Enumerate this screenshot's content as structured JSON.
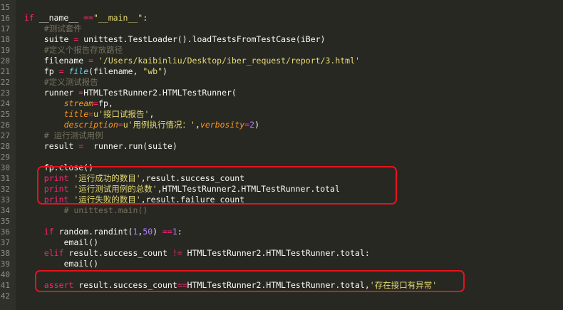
{
  "editor": {
    "language": "python",
    "theme_colors": {
      "background": "#272822",
      "keyword": "#f92672",
      "string": "#e6db74",
      "number": "#ae81ff",
      "comment": "#75715e",
      "param": "#fd971f",
      "builtin": "#66d9ef",
      "highlight_box": "#e8121c"
    },
    "lines": [
      {
        "num": "15",
        "indent": "",
        "tokens": []
      },
      {
        "num": "16",
        "indent": "",
        "tokens": [
          {
            "t": "kw",
            "v": "if"
          },
          {
            "t": "p",
            "v": " __name__ "
          },
          {
            "t": "op",
            "v": "=="
          },
          {
            "t": "str",
            "v": "\"__main__\""
          },
          {
            "t": "p",
            "v": ":"
          }
        ]
      },
      {
        "num": "17",
        "indent": "    ",
        "tokens": [
          {
            "t": "cmt",
            "v": "#测试套件"
          }
        ]
      },
      {
        "num": "18",
        "indent": "    ",
        "tokens": [
          {
            "t": "p",
            "v": "suite "
          },
          {
            "t": "op",
            "v": "="
          },
          {
            "t": "p",
            "v": " unittest.TestLoader().loadTestsFromTestCase(iBer)"
          }
        ]
      },
      {
        "num": "19",
        "indent": "    ",
        "tokens": [
          {
            "t": "cmt",
            "v": "#定义个报告存放路径"
          }
        ]
      },
      {
        "num": "20",
        "indent": "    ",
        "tokens": [
          {
            "t": "p",
            "v": "filename "
          },
          {
            "t": "op",
            "v": "="
          },
          {
            "t": "p",
            "v": " "
          },
          {
            "t": "str",
            "v": "'/Users/kaibinliu/Desktop/iber_request/report/3.html'"
          }
        ]
      },
      {
        "num": "21",
        "indent": "    ",
        "tokens": [
          {
            "t": "p",
            "v": "fp "
          },
          {
            "t": "op",
            "v": "="
          },
          {
            "t": "p",
            "v": " "
          },
          {
            "t": "builtin",
            "v": "file"
          },
          {
            "t": "p",
            "v": "(filename, "
          },
          {
            "t": "str",
            "v": "\"wb\""
          },
          {
            "t": "p",
            "v": ")"
          }
        ]
      },
      {
        "num": "22",
        "indent": "    ",
        "tokens": [
          {
            "t": "cmt",
            "v": "#定义测试报告"
          }
        ]
      },
      {
        "num": "23",
        "indent": "    ",
        "tokens": [
          {
            "t": "p",
            "v": "runner "
          },
          {
            "t": "op",
            "v": "="
          },
          {
            "t": "p",
            "v": "HTMLTestRunner2.HTMLTestRunner("
          }
        ]
      },
      {
        "num": "24",
        "indent": "        ",
        "tokens": [
          {
            "t": "param",
            "v": "stream"
          },
          {
            "t": "op",
            "v": "="
          },
          {
            "t": "p",
            "v": "fp,"
          }
        ]
      },
      {
        "num": "25",
        "indent": "        ",
        "tokens": [
          {
            "t": "param",
            "v": "title"
          },
          {
            "t": "op",
            "v": "="
          },
          {
            "t": "str",
            "v": "u'接口试报告'"
          },
          {
            "t": "p",
            "v": ","
          }
        ]
      },
      {
        "num": "26",
        "indent": "        ",
        "tokens": [
          {
            "t": "param",
            "v": "description"
          },
          {
            "t": "op",
            "v": "="
          },
          {
            "t": "str",
            "v": "u'用例执行情况：'"
          },
          {
            "t": "p",
            "v": ","
          },
          {
            "t": "param",
            "v": "verbosity"
          },
          {
            "t": "op",
            "v": "="
          },
          {
            "t": "num",
            "v": "2"
          },
          {
            "t": "p",
            "v": ")"
          }
        ]
      },
      {
        "num": "27",
        "indent": "    ",
        "tokens": [
          {
            "t": "cmt",
            "v": "# 运行测试用例"
          }
        ]
      },
      {
        "num": "28",
        "indent": "    ",
        "tokens": [
          {
            "t": "p",
            "v": "result "
          },
          {
            "t": "op",
            "v": "="
          },
          {
            "t": "p",
            "v": "  runner.run(suite)"
          }
        ]
      },
      {
        "num": "29",
        "indent": "",
        "tokens": []
      },
      {
        "num": "30",
        "indent": "    ",
        "tokens": [
          {
            "t": "p",
            "v": "fp.close()"
          }
        ]
      },
      {
        "num": "31",
        "indent": "    ",
        "tokens": [
          {
            "t": "kw",
            "v": "print"
          },
          {
            "t": "p",
            "v": " "
          },
          {
            "t": "str",
            "v": "'运行成功的数目'"
          },
          {
            "t": "p",
            "v": ",result.success_count"
          }
        ]
      },
      {
        "num": "32",
        "indent": "    ",
        "tokens": [
          {
            "t": "kw",
            "v": "print"
          },
          {
            "t": "p",
            "v": " "
          },
          {
            "t": "str",
            "v": "'运行测试用例的总数'"
          },
          {
            "t": "p",
            "v": ",HTMLTestRunner2.HTMLTestRunner.total"
          }
        ]
      },
      {
        "num": "33",
        "indent": "    ",
        "tokens": [
          {
            "t": "kw",
            "v": "print"
          },
          {
            "t": "p",
            "v": " "
          },
          {
            "t": "str",
            "v": "'运行失败的数目'"
          },
          {
            "t": "p",
            "v": ",result.failure_count"
          }
        ]
      },
      {
        "num": "34",
        "indent": "        ",
        "tokens": [
          {
            "t": "cmt",
            "v": "# unittest.main()"
          }
        ]
      },
      {
        "num": "35",
        "indent": "",
        "tokens": []
      },
      {
        "num": "36",
        "indent": "    ",
        "tokens": [
          {
            "t": "kw",
            "v": "if"
          },
          {
            "t": "p",
            "v": " random.randint("
          },
          {
            "t": "num",
            "v": "1"
          },
          {
            "t": "p",
            "v": ","
          },
          {
            "t": "num",
            "v": "50"
          },
          {
            "t": "p",
            "v": ") "
          },
          {
            "t": "op",
            "v": "=="
          },
          {
            "t": "num",
            "v": "1"
          },
          {
            "t": "p",
            "v": ":"
          }
        ]
      },
      {
        "num": "37",
        "indent": "        ",
        "tokens": [
          {
            "t": "p",
            "v": "email()"
          }
        ]
      },
      {
        "num": "38",
        "indent": "    ",
        "tokens": [
          {
            "t": "kw",
            "v": "elif"
          },
          {
            "t": "p",
            "v": " result.success_count "
          },
          {
            "t": "op",
            "v": "!="
          },
          {
            "t": "p",
            "v": " HTMLTestRunner2.HTMLTestRunner.total:"
          }
        ]
      },
      {
        "num": "39",
        "indent": "        ",
        "tokens": [
          {
            "t": "p",
            "v": "email()"
          }
        ]
      },
      {
        "num": "40",
        "indent": "",
        "tokens": []
      },
      {
        "num": "41",
        "indent": "    ",
        "tokens": [
          {
            "t": "kw",
            "v": "assert"
          },
          {
            "t": "p",
            "v": " result.success_count"
          },
          {
            "t": "op",
            "v": "=="
          },
          {
            "t": "p",
            "v": "HTMLTestRunner2.HTMLTestRunner.total,"
          },
          {
            "t": "str",
            "v": "'存在接口有异常'"
          }
        ]
      },
      {
        "num": "42",
        "indent": "",
        "tokens": []
      }
    ]
  }
}
